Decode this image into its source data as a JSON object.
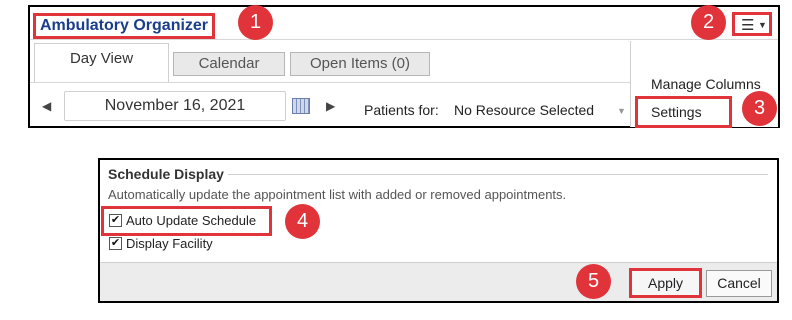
{
  "top": {
    "app_title": "Ambulatory Organizer",
    "menu_icon": "hamburger-menu-icon",
    "tabs": [
      {
        "label": "Day View"
      },
      {
        "label": "Calendar"
      },
      {
        "label": "Open Items  (0)"
      }
    ],
    "date": "November 16, 2021",
    "patients_label": "Patients for:",
    "patients_value": "No Resource Selected",
    "menu_items": [
      {
        "label": "Manage Columns"
      },
      {
        "label": "Settings"
      }
    ]
  },
  "schedule_display": {
    "title": "Schedule Display",
    "description": "Automatically update the appointment list with added or removed appointments.",
    "options": [
      {
        "label": "Auto Update Schedule",
        "checked": true
      },
      {
        "label": "Display Facility",
        "checked": true
      }
    ],
    "apply_label": "Apply",
    "cancel_label": "Cancel"
  },
  "steps": [
    "1",
    "2",
    "3",
    "4",
    "5"
  ],
  "colors": {
    "highlight": "#e0343a",
    "title": "#1b3e8c"
  }
}
